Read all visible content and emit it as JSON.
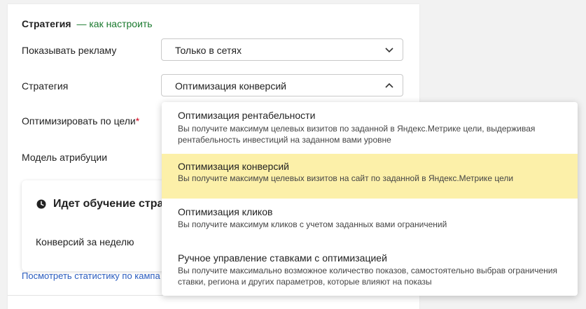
{
  "section": {
    "title": "Стратегия",
    "dash": "—",
    "howto_link": "как настроить"
  },
  "form": {
    "show_ads_label": "Показывать рекламу",
    "show_ads_value": "Только в сетях",
    "strategy_label": "Стратегия",
    "strategy_value": "Оптимизация конверсий",
    "optimize_goal_label": "Оптимизировать по цели",
    "required_mark": "*",
    "attribution_label": "Модель атрибуции"
  },
  "learning": {
    "heading": "Идет обучение страте",
    "conversions_label": "Конверсий за неделю"
  },
  "stats_link": "Посмотреть статистику по кампа",
  "dropdown": {
    "selected_index": 1,
    "options": [
      {
        "title": "Оптимизация рентабельности",
        "description": "Вы получите максимум целевых визитов по заданной в Яндекс.Метрике цели, выдерживая рентабельность инвестиций на заданном вами уровне"
      },
      {
        "title": "Оптимизация конверсий",
        "description": "Вы получите максимум целевых визитов на сайт по заданной в Яндекс.Метрике цели"
      },
      {
        "title": "Оптимизация кликов",
        "description": "Вы получите максимум кликов с учетом заданных вами ограничений"
      },
      {
        "title": "Ручное управление ставками с оптимизацией",
        "description": "Вы получите максимально возможное количество показов, самостоятельно выбрав ограничения ставки, региона и других параметров, которые влияют на показы"
      }
    ]
  },
  "colors": {
    "accent_green": "#1a7a2e",
    "link_blue": "#2a5cbf",
    "selected_bg": "#fcf0a9",
    "required_red": "#d0021b"
  },
  "icons": {
    "select_closed": "chevron-down-icon",
    "select_open": "chevron-up-icon",
    "learning": "clock-icon"
  }
}
